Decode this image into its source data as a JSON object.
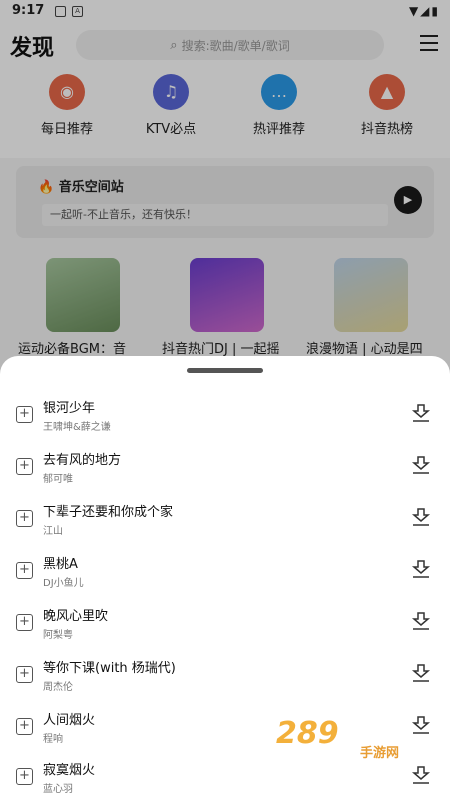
{
  "statusbar": {
    "time": "9:17",
    "icon1": "image-icon",
    "icon2": "a-icon",
    "right_icons": "▼◢▮"
  },
  "header": {
    "title": "发现",
    "search_placeholder": "搜索:歌曲/歌单/歌词"
  },
  "quick": [
    {
      "label": "每日推荐",
      "color": "#e8694a",
      "icon": "◉"
    },
    {
      "label": "KTV必点",
      "color": "#5a67d8",
      "icon": "♫"
    },
    {
      "label": "热评推荐",
      "color": "#2a9ae8",
      "icon": "…"
    },
    {
      "label": "抖音热榜",
      "color": "#e8694a",
      "icon": "▲"
    }
  ],
  "station": {
    "title": "🔥 音乐空间站",
    "subtitle": "一起听-不止音乐，还有快乐！"
  },
  "playlists": [
    {
      "title": "运动必备BGM：音乐不止，运动不停",
      "color": "#7fae6c"
    },
    {
      "title": "抖音热门DJ | 一起摇摆，燃烧你的激情",
      "color": "#9a4fd6"
    },
    {
      "title": "浪漫物语 | 心动是四季流转的暗情",
      "color": "#c9d9a8"
    }
  ],
  "songs": [
    {
      "name": "银河少年",
      "artist": "王啸坤&薛之谦"
    },
    {
      "name": "去有风的地方",
      "artist": "郁可唯"
    },
    {
      "name": "下辈子还要和你成个家",
      "artist": "江山"
    },
    {
      "name": "黑桃A",
      "artist": "DJ小鱼儿"
    },
    {
      "name": "晚风心里吹",
      "artist": "阿梨粤"
    },
    {
      "name": "等你下课(with 杨瑞代)",
      "artist": "周杰伦"
    },
    {
      "name": "人间烟火",
      "artist": "程响"
    },
    {
      "name": "寂寞烟火",
      "artist": "蓝心羽"
    }
  ],
  "watermark": {
    "main": "289",
    "sub": "手游网"
  }
}
